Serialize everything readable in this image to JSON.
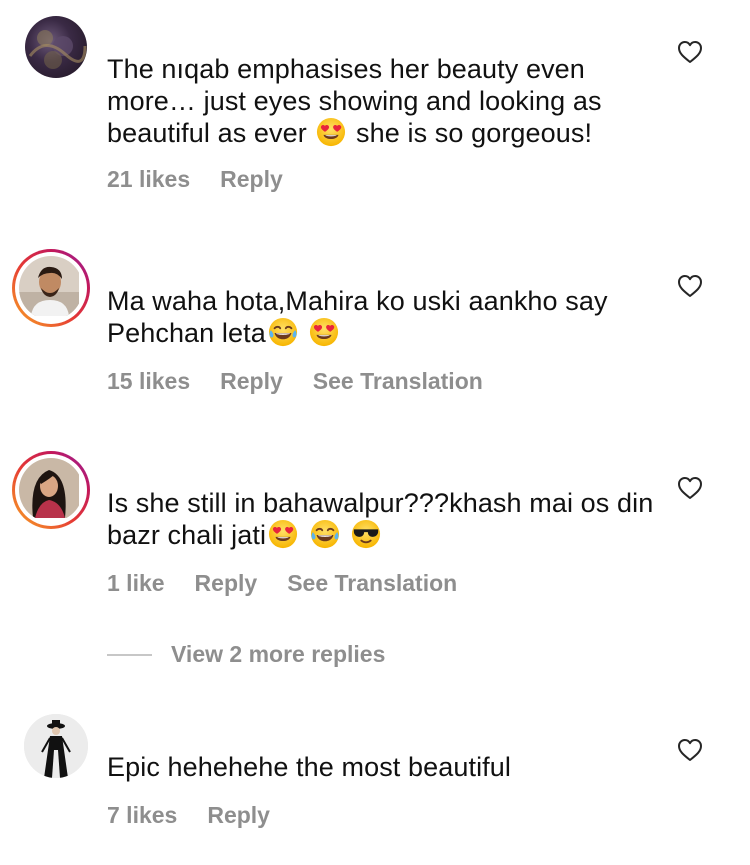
{
  "comments": [
    {
      "text_parts": [
        "The nıqab emphasises her beauty even more… just eyes showing and looking as beautiful as ever ",
        " she is so gorgeous!"
      ],
      "emojis": [
        "heart-eyes-emoji"
      ],
      "likes": "21 likes",
      "reply": "Reply"
    },
    {
      "text_parts": [
        "Ma waha hota,Mahira ko uski aankho say Pehchan leta"
      ],
      "emojis": [
        "tears-of-joy-emoji",
        "heart-eyes-emoji"
      ],
      "likes": "15 likes",
      "reply": "Reply",
      "translate": "See Translation"
    },
    {
      "text_parts": [
        "Is she still in bahawalpur???khash mai os din bazr chali jati"
      ],
      "emojis": [
        "heart-eyes-emoji",
        "tears-of-joy-emoji",
        "sunglasses-emoji"
      ],
      "likes": "1 like",
      "reply": "Reply",
      "translate": "See Translation",
      "view_replies": "View 2 more replies"
    },
    {
      "text_parts": [
        "Epic hehehehe the most beautiful"
      ],
      "emojis": [],
      "likes": "7 likes",
      "reply": "Reply"
    }
  ],
  "colors": {
    "text": "#111111",
    "meta": "#8e8e8e",
    "story_ring": [
      "#f9a825",
      "#e53935",
      "#c2185b",
      "#8e24aa"
    ]
  }
}
